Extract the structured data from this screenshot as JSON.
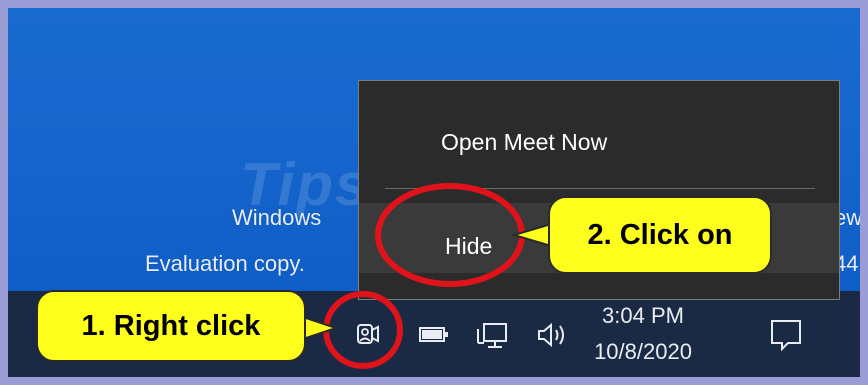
{
  "desktop": {
    "line1_left": "Windows",
    "line1_right": "ew",
    "line2_left": "Evaluation copy.",
    "line2_right": "44",
    "watermark": "TipsMake"
  },
  "context_menu": {
    "items": [
      {
        "label": "Open Meet Now"
      },
      {
        "label": "Hide"
      }
    ]
  },
  "taskbar": {
    "tray_icons": [
      "meet-now-icon",
      "battery-icon",
      "network-icon",
      "volume-icon"
    ],
    "clock": {
      "time": "3:04 PM",
      "date": "10/8/2020"
    },
    "notification_icon": "action-center-icon"
  },
  "annotations": {
    "step1": "1. Right click",
    "step2": "2. Click on",
    "callout_color": "#ffff1e",
    "circle_color": "#e0131b"
  }
}
